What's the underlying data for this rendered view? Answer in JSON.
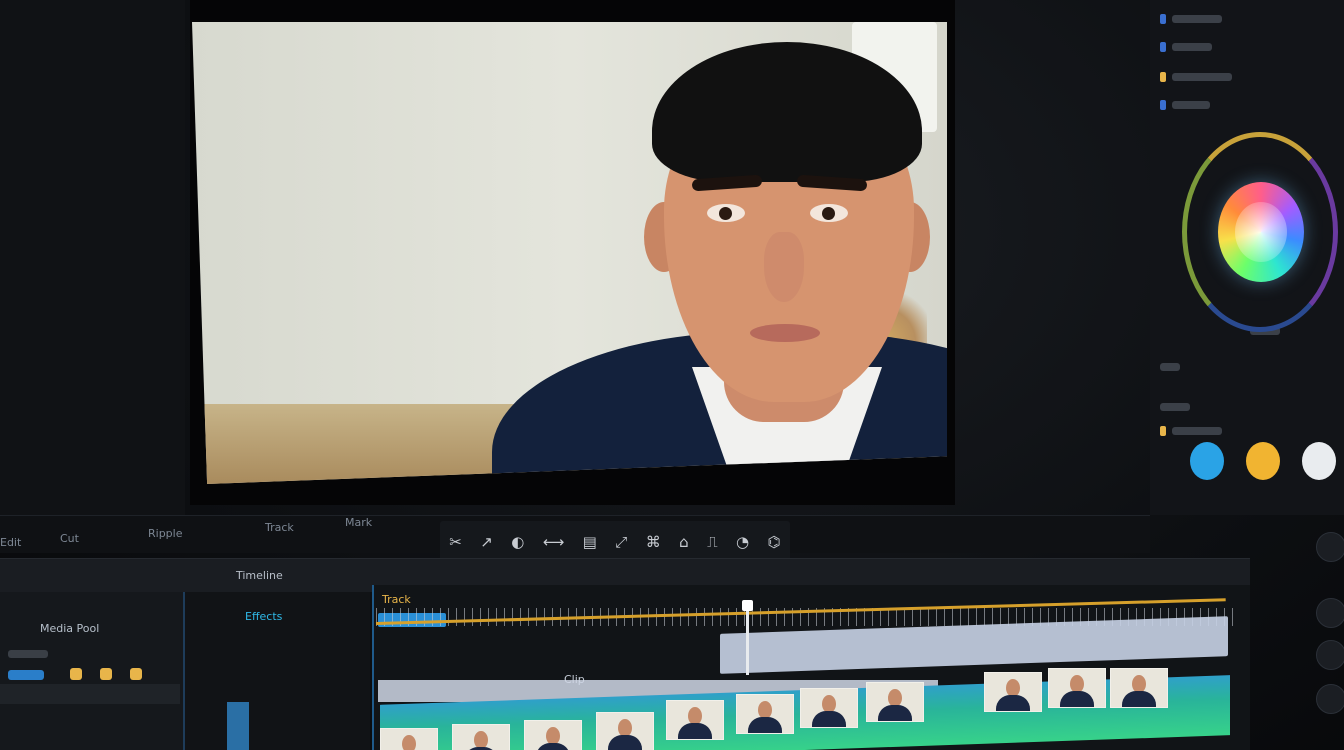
{
  "app": {
    "title": ""
  },
  "status_bar": {
    "items": [
      "Edit",
      "Cut",
      "Ripple",
      "Track",
      "Mark"
    ]
  },
  "toolbar": {
    "tools": [
      "✂",
      "↗",
      "◐",
      "⟷",
      "▤",
      "⤢",
      "⌘",
      "⌂",
      "⎍",
      "◔",
      "⌬"
    ]
  },
  "mid_bar": {
    "label": "Timeline"
  },
  "bin": {
    "title": "Media Pool"
  },
  "effects": {
    "title": "Effects"
  },
  "timeline": {
    "track_label": "Track",
    "clip_label": "Clip"
  },
  "colors": {
    "accent": "#2fb9e8",
    "playhead": "#e8ebee",
    "marker": "#d6a02b",
    "clip_green": "#37d28a"
  },
  "icons": [
    "scissors-icon",
    "arrow-icon",
    "color-wheel-icon",
    "play-icon",
    "settings-icon"
  ]
}
